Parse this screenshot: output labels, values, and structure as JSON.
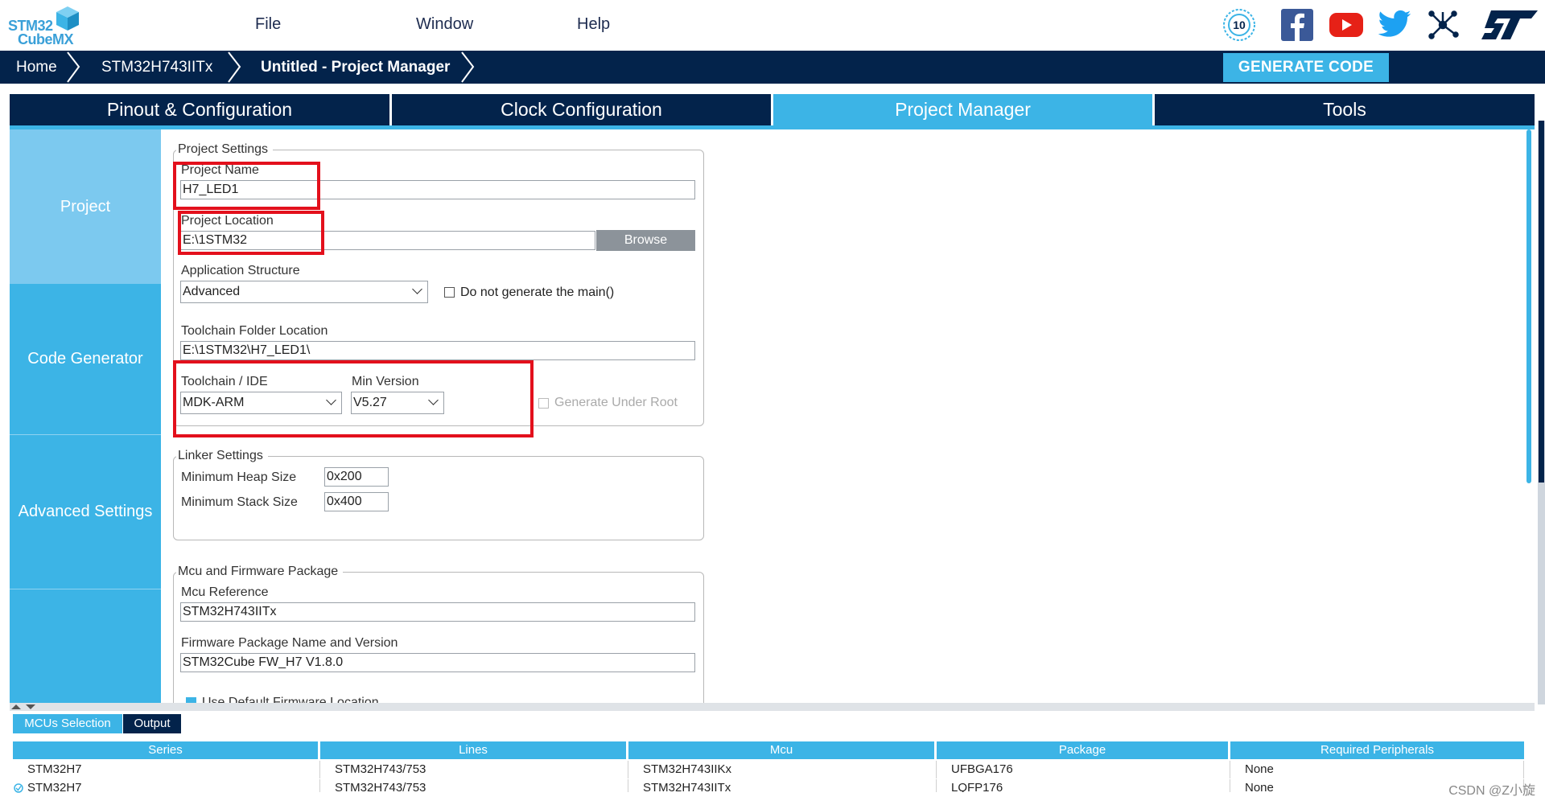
{
  "app": {
    "logo_line1": "STM32",
    "logo_line2": "CubeMX"
  },
  "menu": [
    {
      "label": "File"
    },
    {
      "label": "Window"
    },
    {
      "label": "Help"
    }
  ],
  "social_icons": [
    "anniversary-badge-icon",
    "facebook-icon",
    "youtube-icon",
    "twitter-icon",
    "network-icon",
    "st-logo-icon"
  ],
  "breadcrumb": [
    {
      "label": "Home"
    },
    {
      "label": "STM32H743IITx"
    },
    {
      "label": "Untitled - Project Manager"
    }
  ],
  "generate_button": "GENERATE CODE",
  "tabs": [
    {
      "label": "Pinout & Configuration",
      "active": false
    },
    {
      "label": "Clock Configuration",
      "active": false
    },
    {
      "label": "Project Manager",
      "active": true
    },
    {
      "label": "Tools",
      "active": false
    }
  ],
  "left_nav": [
    {
      "label": "Project",
      "active": true
    },
    {
      "label": "Code Generator",
      "active": false
    },
    {
      "label": "Advanced Settings",
      "active": false
    }
  ],
  "project_settings": {
    "legend": "Project Settings",
    "name_label": "Project Name",
    "name_value": "H7_LED1",
    "location_label": "Project Location",
    "location_value": "E:\\1STM32",
    "browse_label": "Browse",
    "app_structure_label": "Application Structure",
    "app_structure_value": "Advanced",
    "no_main_label": "Do not generate the main()",
    "toolchain_folder_label": "Toolchain Folder Location",
    "toolchain_folder_value": "E:\\1STM32\\H7_LED1\\",
    "toolchain_label": "Toolchain / IDE",
    "toolchain_value": "MDK-ARM",
    "min_version_label": "Min Version",
    "min_version_value": "V5.27",
    "generate_under_root_label": "Generate Under Root"
  },
  "linker_settings": {
    "legend": "Linker Settings",
    "heap_label": "Minimum Heap Size",
    "heap_value": "0x200",
    "stack_label": "Minimum Stack Size",
    "stack_value": "0x400"
  },
  "mcu_package": {
    "legend": "Mcu and Firmware Package",
    "mcu_ref_label": "Mcu Reference",
    "mcu_ref_value": "STM32H743IITx",
    "fw_label": "Firmware Package Name and Version",
    "fw_value": "STM32Cube FW_H7 V1.8.0",
    "default_fw_label": "Use Default Firmware Location"
  },
  "bottom_tabs": [
    {
      "label": "MCUs Selection",
      "active": false
    },
    {
      "label": "Output",
      "active": true
    }
  ],
  "table": {
    "headers": [
      "Series",
      "Lines",
      "Mcu",
      "Package",
      "Required Peripherals"
    ],
    "rows": [
      [
        "STM32H7",
        "STM32H743/753",
        "STM32H743IIKx",
        "UFBGA176",
        "None"
      ],
      [
        "STM32H7",
        "STM32H743/753",
        "STM32H743IITx",
        "LQFP176",
        "None"
      ]
    ]
  },
  "watermark": "CSDN @Z小旋",
  "colors": {
    "navy": "#03234b",
    "accent": "#3cb4e6",
    "highlight_red": "#e3101c"
  }
}
